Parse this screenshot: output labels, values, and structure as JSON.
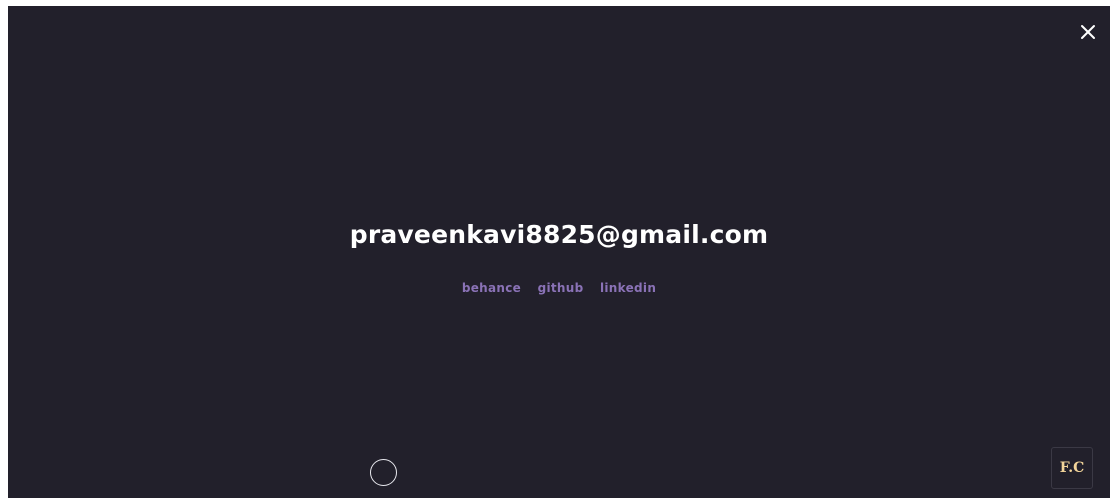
{
  "contact": {
    "email": "praveenkavi8825@gmail.com"
  },
  "social_links": [
    {
      "label": "behance"
    },
    {
      "label": "github"
    },
    {
      "label": "linkedin"
    }
  ],
  "close_button": {
    "icon": "close-icon"
  },
  "logo": {
    "text": "F.C"
  },
  "colors": {
    "background": "#22202b",
    "email_text": "#ffffff",
    "link_text": "#8a72b6",
    "logo_text": "#f2d49a"
  }
}
